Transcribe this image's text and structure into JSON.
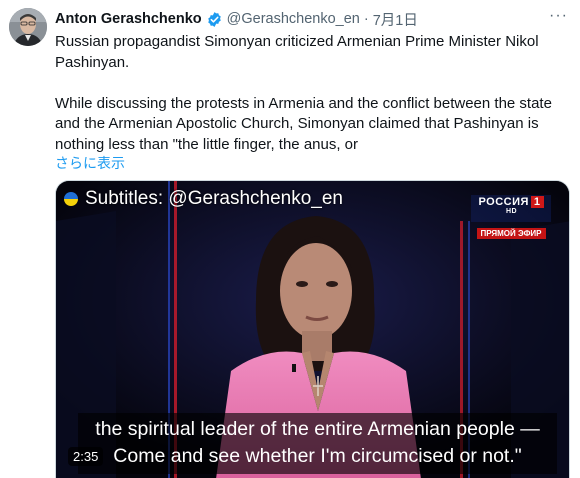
{
  "tweet": {
    "author_name": "Anton Gerashchenko",
    "handle": "@Gerashchenko_en",
    "separator": "·",
    "date": "7月1日",
    "more_label": "···",
    "paragraph1": "Russian propagandist Simonyan criticized Armenian Prime Minister Nikol Pashinyan.",
    "paragraph2": "While discussing the protests in Armenia and the conflict between the state and the Armenian Apostolic Church, Simonyan claimed that Pashinyan is nothing less than \"the little finger, the anus, or",
    "show_more": "さらに表示"
  },
  "video": {
    "subtitle_credit": "Subtitles: @Gerashchenko_en",
    "channel_name": "РОССИЯ",
    "channel_number": "1",
    "channel_hd": "HD",
    "channel_live": "ПРЯМОЙ ЭФИР",
    "caption_line1": "the spiritual leader of the entire Armenian people —",
    "caption_line2": "Come and see whether I'm circumcised or not.\"",
    "duration": "2:35"
  },
  "colors": {
    "accent": "#1d9bf0",
    "verified": "#1d9bf0",
    "jacket": "#e97fb6"
  }
}
